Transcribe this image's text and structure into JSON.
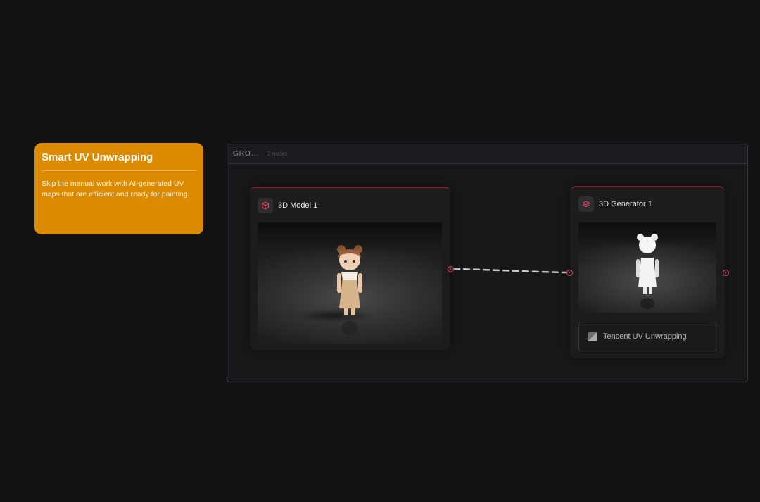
{
  "note": {
    "title": "Smart UV Unwrapping",
    "body": "Skip the manual work with AI-generated UV maps that are efficient and ready for painting."
  },
  "group": {
    "title": "GRO...",
    "count": "2 nodes"
  },
  "nodes": [
    {
      "title": "3D Model 1",
      "icon": "cube-icon"
    },
    {
      "title": "3D Generator 1",
      "icon": "layers-icon",
      "model": "Tencent UV Unwrapping"
    }
  ],
  "colors": {
    "note": "#dc8a00",
    "port": "#e0485a",
    "accent_border": "#7a2530",
    "background": "#121212"
  }
}
